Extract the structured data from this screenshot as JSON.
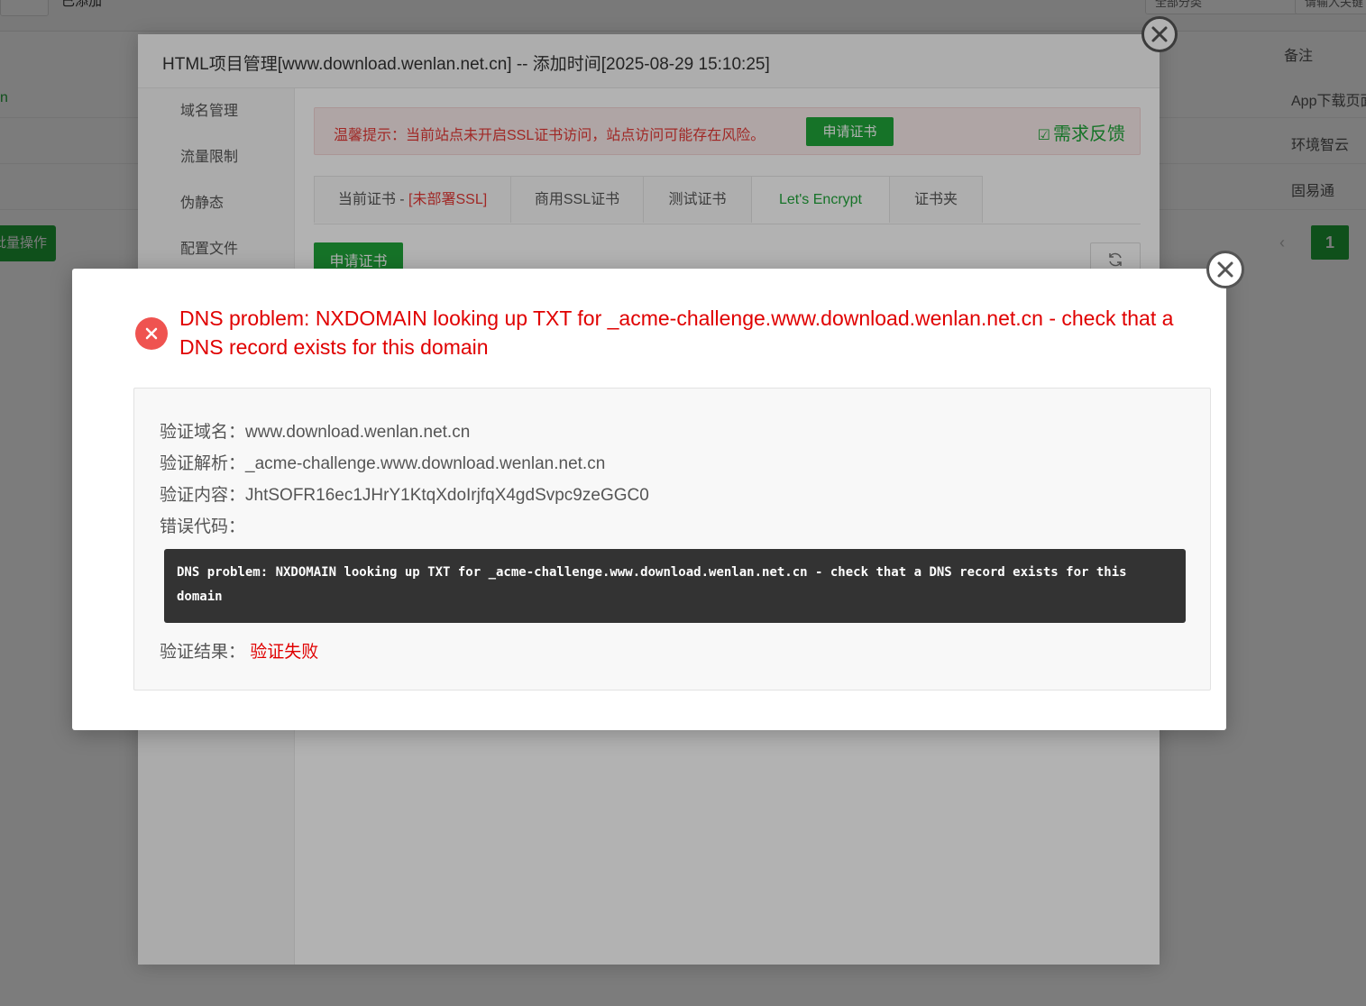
{
  "background": {
    "column_header": "备注",
    "rows": [
      "App下载页面",
      "环境智云",
      "固易通"
    ],
    "batch_button": "批量操作",
    "page_number": "1",
    "page_prev": "‹",
    "title_fragment": "已添加",
    "top_box_1": "全部分类",
    "top_box_2": "请输入关键",
    "green_fragment": "n"
  },
  "site_dialog": {
    "title": "HTML项目管理[www.download.wenlan.net.cn] -- 添加时间[2025-08-29 15:10:25]",
    "sidebar": [
      {
        "label": "域名管理"
      },
      {
        "label": "流量限制"
      },
      {
        "label": "伪静态"
      },
      {
        "label": "配置文件"
      }
    ],
    "ssl_tip": {
      "text": "温馨提示：当前站点未开启SSL证书访问，站点访问可能存在风险。",
      "apply_button": "申请证书",
      "feedback_icon": "☑",
      "feedback": "需求反馈"
    },
    "tabs": {
      "current_prefix": "当前证书 - ",
      "current_status": "[未部署SSL]",
      "commercial": "商用SSL证书",
      "test": "测试证书",
      "letsencrypt": "Let's Encrypt",
      "folder": "证书夹"
    },
    "apply_button_2": "申请证书"
  },
  "error_dialog": {
    "title": "DNS problem: NXDOMAIN looking up TXT for _acme-challenge.www.download.wenlan.net.cn - check that a DNS record exists for this domain",
    "verify_domain_label": "验证域名：",
    "verify_domain": "www.download.wenlan.net.cn",
    "verify_record_label": "验证解析：",
    "verify_record": "_acme-challenge.www.download.wenlan.net.cn",
    "verify_content_label": "验证内容：",
    "verify_content": "JhtSOFR16ec1JHrY1KtqXdoIrjfqX4gdSvpc9zeGGC0",
    "error_code_label": "错误代码：",
    "error_code": "DNS problem: NXDOMAIN looking up TXT for _acme-challenge.www.download.wenlan.net.cn - check that a DNS record exists for this domain",
    "result_label": "验证结果：",
    "result": "验证失败"
  },
  "colors": {
    "brand_green": "#20a53a",
    "error_red": "#e00000",
    "error_icon": "#ef5350",
    "code_bg": "#333333"
  }
}
